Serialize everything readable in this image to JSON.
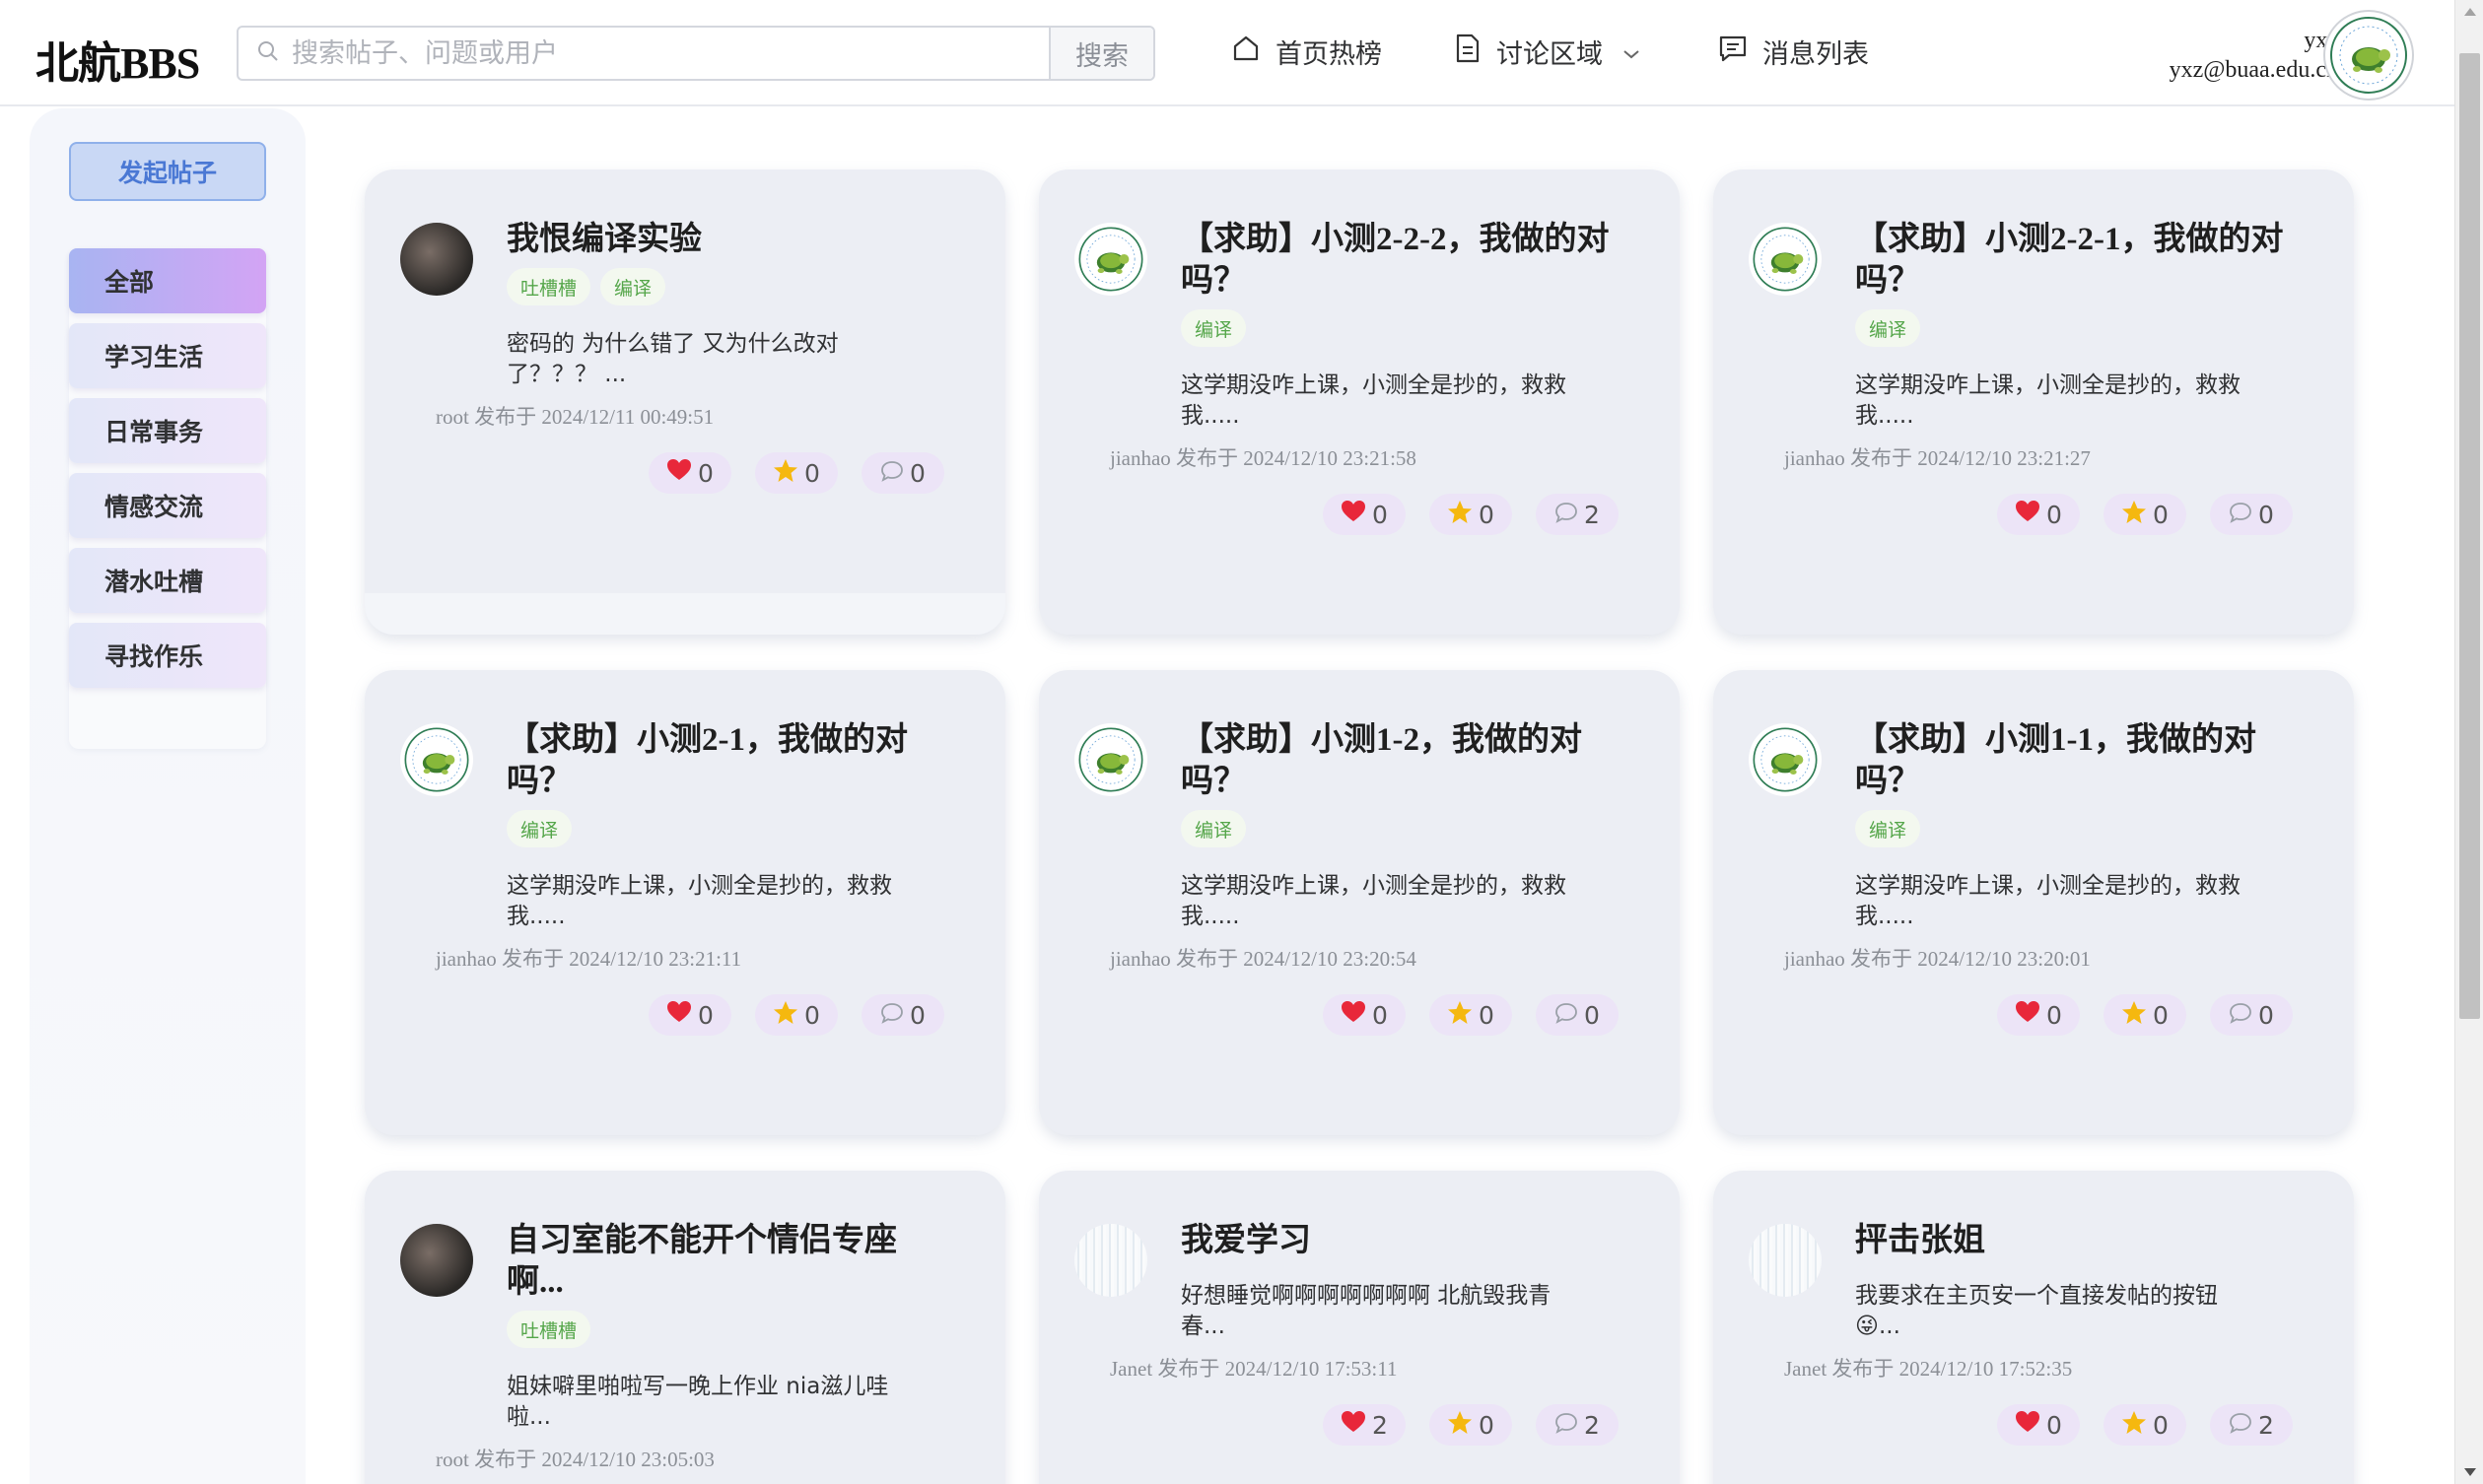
{
  "header": {
    "logo": "北航BBS",
    "search_placeholder": "搜索帖子、问题或用户",
    "search_button": "搜索",
    "nav": [
      {
        "label": "首页热榜",
        "icon": "home-icon"
      },
      {
        "label": "讨论区域",
        "icon": "document-icon"
      },
      {
        "label": "消息列表",
        "icon": "message-icon"
      }
    ],
    "user_name": "yxz",
    "user_email": "yxz@buaa.edu.cn"
  },
  "sidebar": {
    "post_button": "发起帖子",
    "categories": [
      "全部",
      "学习生活",
      "日常事务",
      "情感交流",
      "潜水吐槽",
      "寻找作乐"
    ],
    "active_index": 0
  },
  "posts": [
    {
      "avatar": "dark",
      "title": "我恨编译实验",
      "tags": [
        "吐槽槽",
        "编译"
      ],
      "body": "密码的 为什么错了 又为什么改对了？？？ ...",
      "meta": "root 发布于 2024/12/11 00:49:51",
      "likes": "0",
      "stars": "0",
      "comments": "0"
    },
    {
      "avatar": "turtle",
      "title": "【求助】小测2-2-2，我做的对吗？",
      "tags": [
        "编译"
      ],
      "body": "这学期没咋上课，小测全是抄的，救救我.....",
      "meta": "jianhao 发布于 2024/12/10 23:21:58",
      "likes": "0",
      "stars": "0",
      "comments": "2"
    },
    {
      "avatar": "turtle",
      "title": "【求助】小测2-2-1，我做的对吗？",
      "tags": [
        "编译"
      ],
      "body": "这学期没咋上课，小测全是抄的，救救我.....",
      "meta": "jianhao 发布于 2024/12/10 23:21:27",
      "likes": "0",
      "stars": "0",
      "comments": "0"
    },
    {
      "avatar": "turtle",
      "title": "【求助】小测2-1，我做的对吗？",
      "tags": [
        "编译"
      ],
      "body": "这学期没咋上课，小测全是抄的，救救我.....",
      "meta": "jianhao 发布于 2024/12/10 23:21:11",
      "likes": "0",
      "stars": "0",
      "comments": "0"
    },
    {
      "avatar": "turtle",
      "title": "【求助】小测1-2，我做的对吗？",
      "tags": [
        "编译"
      ],
      "body": "这学期没咋上课，小测全是抄的，救救我.....",
      "meta": "jianhao 发布于 2024/12/10 23:20:54",
      "likes": "0",
      "stars": "0",
      "comments": "0"
    },
    {
      "avatar": "turtle",
      "title": "【求助】小测1-1，我做的对吗？",
      "tags": [
        "编译"
      ],
      "body": "这学期没咋上课，小测全是抄的，救救我.....",
      "meta": "jianhao 发布于 2024/12/10 23:20:01",
      "likes": "0",
      "stars": "0",
      "comments": "0"
    },
    {
      "avatar": "dark",
      "title": "自习室能不能开个情侣专座啊...",
      "tags": [
        "吐槽槽"
      ],
      "body": "姐妹噼里啪啦写一晚上作业 nia滋儿哇啦...",
      "meta": "root 发布于 2024/12/10 23:05:03",
      "likes": "",
      "stars": "",
      "comments": ""
    },
    {
      "avatar": "blank",
      "title": "我爱学习",
      "tags": [],
      "body": "好想睡觉啊啊啊啊啊啊啊 北航毁我青春...",
      "meta": "Janet 发布于 2024/12/10 17:53:11",
      "likes": "2",
      "stars": "0",
      "comments": "2"
    },
    {
      "avatar": "blank",
      "title": "抨击张姐",
      "tags": [],
      "body": "我要求在主页安一个直接发帖的按钮😜...",
      "meta": "Janet 发布于 2024/12/10 17:52:35",
      "likes": "0",
      "stars": "0",
      "comments": "2"
    }
  ],
  "colors": {
    "accent": "#4a78d4",
    "tag_green": "#55a64a",
    "card_bg": "#eceef4",
    "stat_bg": "#ece4f7"
  }
}
